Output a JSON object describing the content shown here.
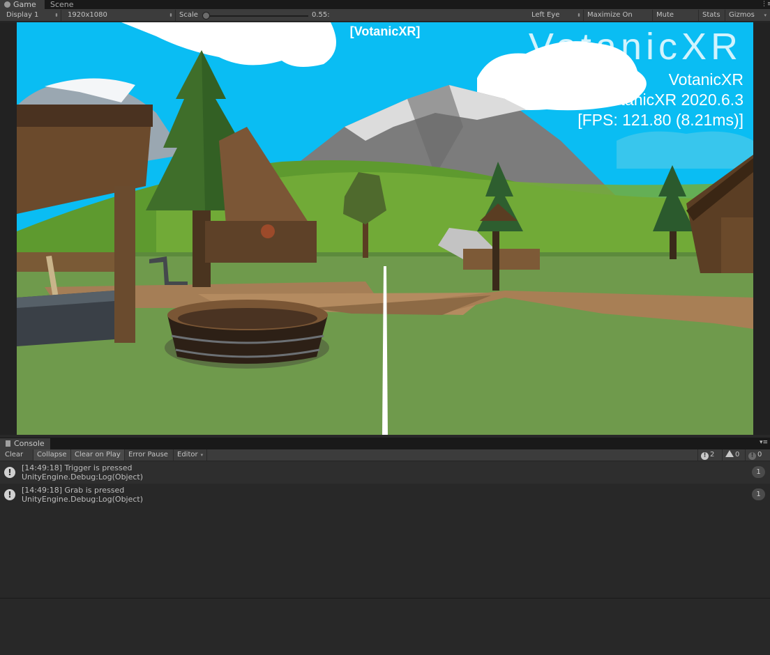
{
  "tabs": [
    {
      "label": "Game",
      "active": true
    },
    {
      "label": "Scene",
      "active": false
    }
  ],
  "toolbar": {
    "display": "Display 1",
    "resolution": "1920x1080",
    "scale_label": "Scale",
    "scale_value": "0.55:",
    "eye": "Left Eye",
    "maximize": "Maximize On Play",
    "mute": "Mute Audio",
    "stats": "Stats",
    "gizmos": "Gizmos"
  },
  "viewport": {
    "title": "[VotanicXR]",
    "logo": "VotanicXR",
    "brand": "VotanicXR",
    "version": "VotanicXR 2020.6.3",
    "fps": "[FPS: 121.80 (8.21ms)]"
  },
  "console": {
    "tab": "Console",
    "buttons": {
      "clear": "Clear",
      "collapse": "Collapse",
      "clear_on_play": "Clear on Play",
      "error_pause": "Error Pause",
      "editor": "Editor"
    },
    "counts": {
      "info": "2",
      "warning": "0",
      "error": "0"
    },
    "logs": [
      {
        "line1": "[14:49:18] Trigger is pressed",
        "line2": "UnityEngine.Debug:Log(Object)",
        "count": "1"
      },
      {
        "line1": "[14:49:18] Grab is pressed",
        "line2": "UnityEngine.Debug:Log(Object)",
        "count": "1"
      }
    ]
  },
  "colors": {
    "sky": "#0abdf3",
    "grass": "#6f9a4c",
    "editor_bg": "#282828",
    "toolbar_bg": "#3c3c3c"
  }
}
